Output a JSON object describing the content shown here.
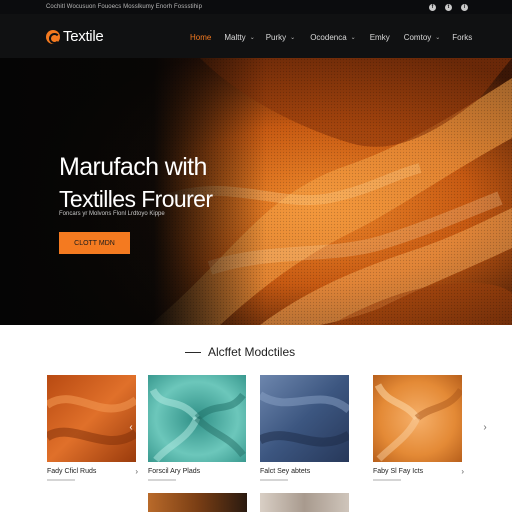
{
  "topbar": {
    "text": "Cochitl Wocusuon Fouoecs Mosslkumy   Enorh Fossstihip",
    "social_icons": [
      "facebook-icon",
      "twitter-icon",
      "instagram-icon"
    ],
    "social_glyphs": [
      "f",
      "t",
      "i"
    ]
  },
  "nav": {
    "logo_text": "Textile",
    "items": [
      {
        "label": "Home",
        "has_dropdown": false,
        "active": true
      },
      {
        "label": "Maltty",
        "has_dropdown": true,
        "active": false
      },
      {
        "label": "Purky",
        "has_dropdown": true,
        "active": false
      },
      {
        "label": "Ocodenca",
        "has_dropdown": true,
        "active": false
      },
      {
        "label": "Emky",
        "has_dropdown": false,
        "active": false
      },
      {
        "label": "Comtoy",
        "has_dropdown": true,
        "active": false
      },
      {
        "label": "Forks",
        "has_dropdown": false,
        "active": false
      }
    ],
    "chevron": "⌄"
  },
  "hero": {
    "title_line1": "Marufach with",
    "title_line2": "Textilles Frourer",
    "subtitle": "Foncars yr Molvons Flonl Lrdtoyo Kippe",
    "button_label": "Clott Mdn"
  },
  "section": {
    "title": "Alcffet Modctiles",
    "cards": [
      {
        "label": "Fady Cficl Ruds"
      },
      {
        "label": "Forscil Ary Plads"
      },
      {
        "label": "Falct Sey abtets"
      },
      {
        "label": "Faby Sl Fay Icts"
      }
    ],
    "card_arrow": "›",
    "slider_prev": "‹",
    "slider_next": "›"
  },
  "colors": {
    "accent": "#f47a20",
    "topbar_bg": "#0b0c0e",
    "nav_bg": "#101112",
    "swatches": [
      "#d2601c",
      "#5fb9ae",
      "#4f6b95",
      "#e9903f"
    ]
  }
}
